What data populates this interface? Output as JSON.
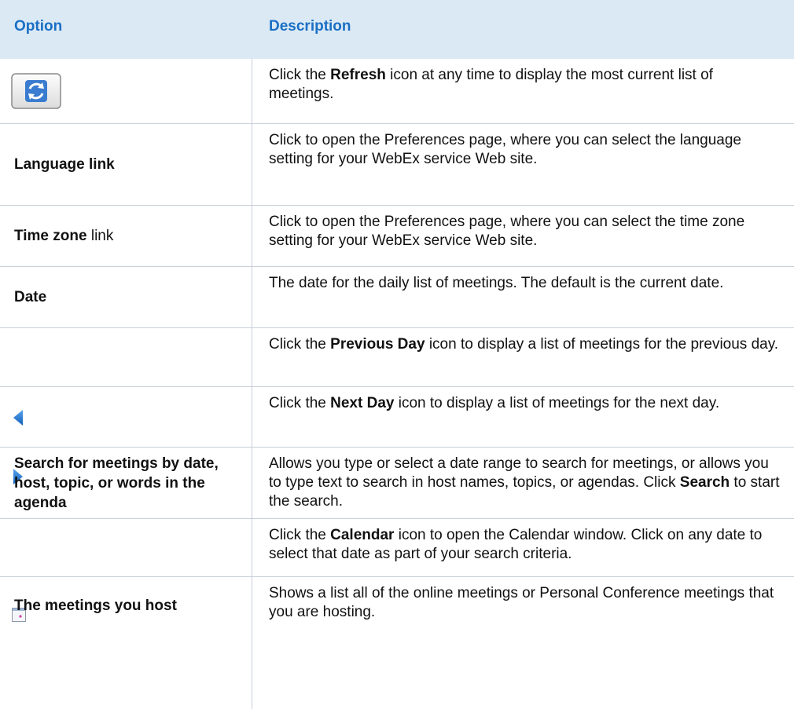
{
  "header": {
    "option": "Option",
    "description": "Description"
  },
  "rows": [
    {
      "option": {
        "icon": "refresh-icon"
      },
      "description": [
        {
          "text": "Click the "
        },
        {
          "text": "Refresh",
          "bold": true
        },
        {
          "text": " icon at any time to display the most current list of meetings."
        }
      ]
    },
    {
      "option": [
        {
          "text": "Language link",
          "bold": true
        }
      ],
      "description": [
        {
          "text": "Click to open the Preferences page, where you can select the language setting for your WebEx service Web site."
        }
      ]
    },
    {
      "option": [
        {
          "text": "Time zone",
          "bold": true
        },
        {
          "text": " link"
        }
      ],
      "description": [
        {
          "text": "Click to open the Preferences page, where you can select the time zone setting for your WebEx service Web site."
        }
      ]
    },
    {
      "option": [
        {
          "text": "Date",
          "bold": true
        }
      ],
      "description": [
        {
          "text": "The date for the daily list of meetings. The default is the current date."
        }
      ]
    },
    {
      "option": {
        "icon": "previous-day-icon"
      },
      "description": [
        {
          "text": "Click the "
        },
        {
          "text": "Previous Day",
          "bold": true
        },
        {
          "text": " icon to display a list of meetings for the previous day."
        }
      ]
    },
    {
      "option": {
        "icon": "next-day-icon"
      },
      "description": [
        {
          "text": "Click the "
        },
        {
          "text": "Next Day",
          "bold": true
        },
        {
          "text": " icon to display a list of meetings for the next day."
        }
      ]
    },
    {
      "option": [
        {
          "text": "Search for meetings by date, host, topic, or words in the agenda",
          "bold": true
        }
      ],
      "description": [
        {
          "text": "Allows you type or select a date range to search for meetings, or allows you to type text to search in host names, topics, or agendas. Click "
        },
        {
          "text": "Search",
          "bold": true
        },
        {
          "text": " to start the search."
        }
      ]
    },
    {
      "option": {
        "icon": "calendar-icon"
      },
      "description": [
        {
          "text": "Click the "
        },
        {
          "text": "Calendar",
          "bold": true
        },
        {
          "text": " icon to open the Calendar window. Click on any date to select that date as part of your search criteria."
        }
      ]
    },
    {
      "option": [
        {
          "text": "The meetings you host",
          "bold": true
        }
      ],
      "description": [
        {
          "text": "Shows a list all of the online meetings or Personal Conference meetings that you are hosting."
        }
      ]
    }
  ],
  "colors": {
    "header_bg": "#dbe9f5",
    "header_text": "#1a6fc4",
    "grid": "#c8cfd8"
  }
}
